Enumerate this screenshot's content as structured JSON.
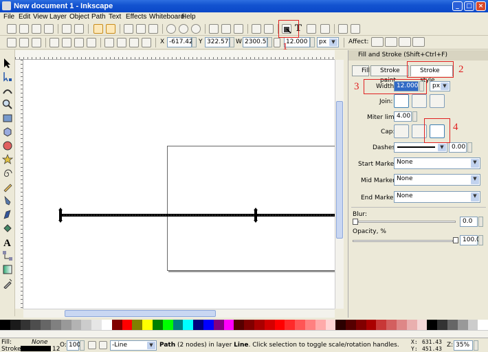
{
  "window": {
    "title": "New document 1 - Inkscape"
  },
  "menu": [
    "File",
    "Edit",
    "View",
    "Layer",
    "Object",
    "Path",
    "Text",
    "Effects",
    "Whiteboard",
    "Help"
  ],
  "toolbar": {
    "x_label": "X",
    "x_value": "-617.42",
    "y_label": "Y",
    "y_value": "322.571",
    "w_label": "W",
    "w_value": "2300.57",
    "h_value": "12.000",
    "unit": "px",
    "affect_label": "Affect:"
  },
  "annotations": {
    "n1": "1",
    "n2": "2",
    "n3": "3",
    "n4": "4"
  },
  "dock": {
    "title": "Fill and Stroke (Shift+Ctrl+F)",
    "tabs": [
      "Fill",
      "Stroke paint",
      "Stroke style"
    ],
    "width_label": "Width:",
    "width_value": "12.000",
    "width_unit": "px",
    "join_label": "Join:",
    "miter_label": "Miter limit:",
    "miter_value": "4.00",
    "cap_label": "Cap:",
    "dashes_label": "Dashes:",
    "dashes_value": "0.00",
    "start_markers_label": "Start Markers:",
    "start_markers_value": "None",
    "mid_markers_label": "Mid Markers:",
    "mid_markers_value": "None",
    "end_markers_label": "End Markers:",
    "end_markers_value": "None",
    "blur_label": "Blur:",
    "blur_value": "0.0",
    "opacity_label": "Opacity, %",
    "opacity_value": "100.0"
  },
  "palette": [
    "#000000",
    "#1a1a1a",
    "#333333",
    "#4d4d4d",
    "#666666",
    "#808080",
    "#999999",
    "#b3b3b3",
    "#cccccc",
    "#e6e6e6",
    "#ffffff",
    "#800000",
    "#ff0000",
    "#808000",
    "#ffff00",
    "#008000",
    "#00ff00",
    "#008080",
    "#00ffff",
    "#000080",
    "#0000ff",
    "#800080",
    "#ff00ff",
    "#550000",
    "#800000",
    "#aa0000",
    "#d40000",
    "#ff0000",
    "#ff2a2a",
    "#ff5555",
    "#ff8080",
    "#ffaaaa",
    "#ffd5d5",
    "#2b0000",
    "#550000",
    "#800000",
    "#aa0000",
    "#c83737",
    "#d35f5f",
    "#de8787",
    "#e9afaf",
    "#f4d7d7",
    "#000000",
    "#333333",
    "#666666",
    "#999999",
    "#cccccc",
    "#ffffff"
  ],
  "status": {
    "fill_label": "Fill:",
    "fill_value": "None",
    "stroke_label": "Stroke:",
    "stroke_width": "12",
    "opacity_label": "O:",
    "opacity_value": "100",
    "layer_value": "-Line",
    "message_bold": "Path",
    "message": "(2 nodes) in layer",
    "message_layer": "Line",
    "message_tail": ". Click selection to toggle scale/rotation handles.",
    "x_label": "X:",
    "x_value": "631.43",
    "y_label": "Y:",
    "y_value": "451.43",
    "zoom_label": "Z:",
    "zoom_value": "35%"
  }
}
